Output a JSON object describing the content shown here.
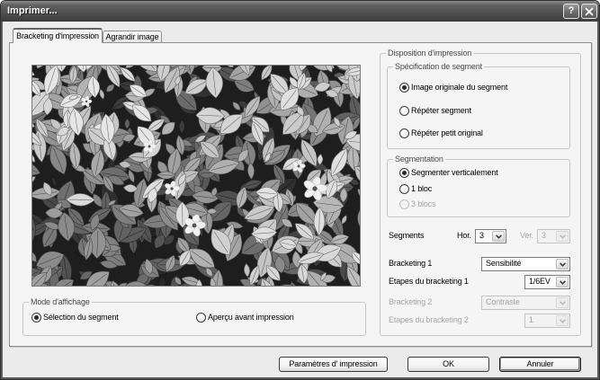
{
  "window": {
    "title": "Imprimer...",
    "help_label": "?"
  },
  "icons": {
    "help": "help-icon",
    "close": "close-icon",
    "dropdown": "chevron-down-icon",
    "radio": "radio-button-icon"
  },
  "colors": {
    "title_bar_top": "#8c8c8c",
    "title_bar_bottom": "#3c3c3c",
    "dialog_bg": "#ebebeb",
    "panel_bg": "#f5f5f5",
    "text": "#000000",
    "disabled_text": "#a6a6a6",
    "group_border": "#c8c8c8"
  },
  "tabs": [
    {
      "label": "Bracketing d'impression",
      "active": true
    },
    {
      "label": "Agrandir image",
      "active": false
    }
  ],
  "display_mode": {
    "legend": "Mode d'affichage",
    "options": [
      {
        "label": "Sélection du segment",
        "checked": true,
        "disabled": false
      },
      {
        "label": "Aperçu avant impression",
        "checked": false,
        "disabled": false
      }
    ]
  },
  "print_layout": {
    "legend": "Disposition d'impression",
    "segment_spec": {
      "legend": "Spécification de segment",
      "options": [
        {
          "label": "Image originale du segment",
          "checked": true,
          "disabled": false
        },
        {
          "label": "Répéter segment",
          "checked": false,
          "disabled": false
        },
        {
          "label": "Répéter petit original",
          "checked": false,
          "disabled": false
        }
      ]
    },
    "segmentation": {
      "legend": "Segmentation",
      "options": [
        {
          "label": "Segmenter verticalement",
          "checked": true,
          "disabled": false
        },
        {
          "label": "1 bloc",
          "checked": false,
          "disabled": false
        },
        {
          "label": "3 blocs",
          "checked": false,
          "disabled": true
        }
      ]
    },
    "segments": {
      "label": "Segments",
      "hor_label": "Hor.",
      "hor_value": "3",
      "hor_disabled": false,
      "ver_label": "Ver.",
      "ver_value": "3",
      "ver_disabled": true
    },
    "bracketing_1": {
      "label": "Bracketing 1",
      "value": "Sensibilité",
      "disabled": false
    },
    "steps_1": {
      "label": "Etapes du bracketing 1",
      "value": "1/6EV",
      "disabled": false
    },
    "bracketing_2": {
      "label": "Bracketing 2",
      "value": "Contraste",
      "disabled": true
    },
    "steps_2": {
      "label": "Etapes du bracketing 2",
      "value": "1",
      "disabled": true
    }
  },
  "buttons": {
    "print_settings": {
      "label": "Paramètres d' impression",
      "focused": false
    },
    "ok": {
      "label": "OK",
      "focused": false
    },
    "cancel": {
      "label": "Annuler",
      "focused": true
    }
  }
}
